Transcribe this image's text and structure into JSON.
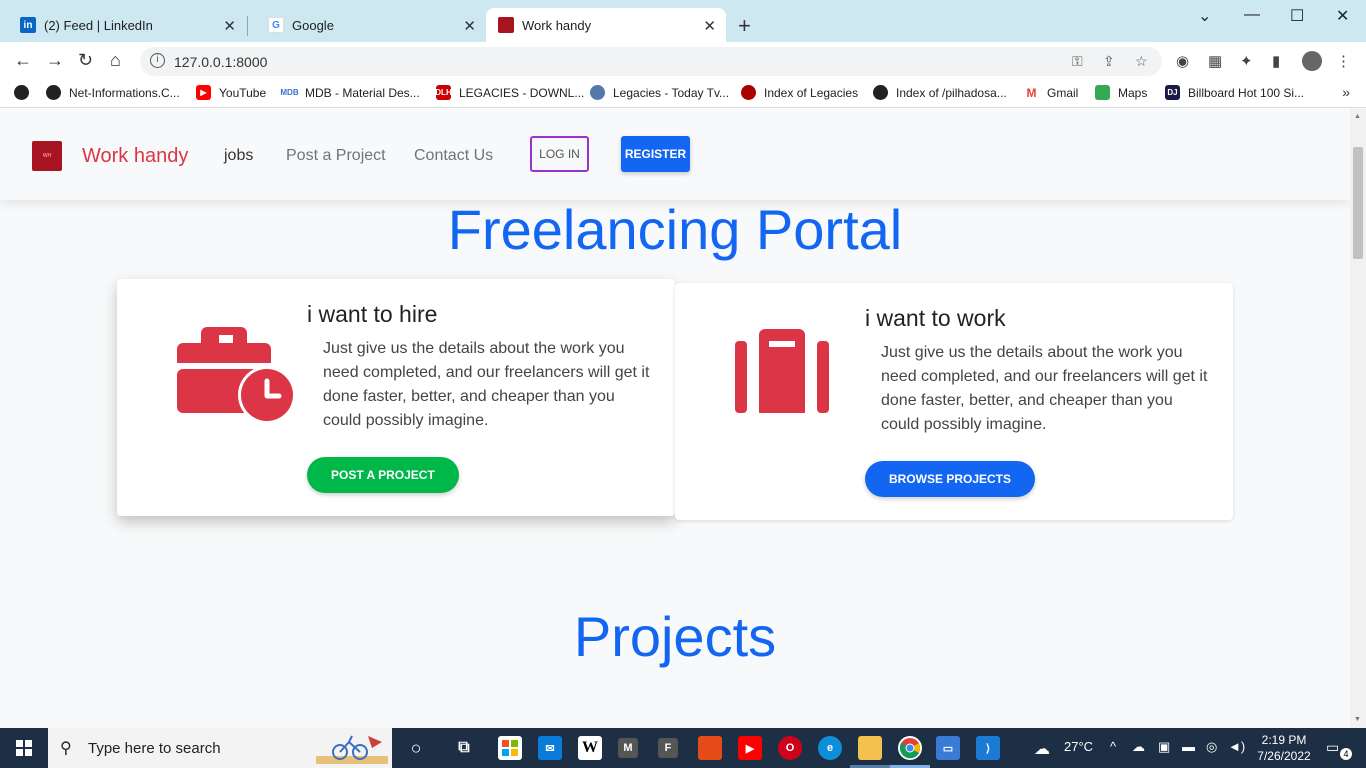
{
  "browser": {
    "tabs": [
      {
        "title": "(2) Feed | LinkedIn",
        "icon": "linkedin-icon"
      },
      {
        "title": "Google",
        "icon": "google-icon"
      },
      {
        "title": "Work handy",
        "icon": "site-icon",
        "active": true
      }
    ],
    "address": "127.0.0.1:8000",
    "bookmarks": [
      {
        "label": "Net-Informations.C...",
        "icon": "globe-icon"
      },
      {
        "label": "YouTube",
        "icon": "youtube-icon"
      },
      {
        "label": "MDB - Material Des...",
        "icon": "mdb-icon"
      },
      {
        "label": "LEGACIES - DOWNL...",
        "icon": "dlh-icon"
      },
      {
        "label": "Legacies - Today Tv...",
        "icon": "film-icon"
      },
      {
        "label": "Index of Legacies",
        "icon": "legacies-icon"
      },
      {
        "label": "Index of /pilhadosa...",
        "icon": "globe-icon"
      },
      {
        "label": "Gmail",
        "icon": "gmail-icon"
      },
      {
        "label": "Maps",
        "icon": "maps-icon"
      },
      {
        "label": "Billboard Hot 100 Si...",
        "icon": "billboard-icon"
      }
    ]
  },
  "site": {
    "brand": "Work handy",
    "nav": [
      "jobs",
      "Post a Project",
      "Contact Us"
    ],
    "login": "LOG IN",
    "register": "REGISTER",
    "hero_title": "Freelancing Portal",
    "cards": [
      {
        "title": "i want to hire",
        "text": "Just give us the details about the work you need completed, and our freelancers will get it done faster, better, and cheaper than you could possibly imagine.",
        "button": "POST A PROJECT",
        "icon": "briefcase-clock-icon"
      },
      {
        "title": "i want to work",
        "text": "Just give us the details about the work you need completed, and our freelancers will get it done faster, better, and cheaper than you could possibly imagine.",
        "button": "BROWSE PROJECTS",
        "icon": "suitcase-icon"
      }
    ],
    "projects_title": "Projects"
  },
  "taskbar": {
    "search_placeholder": "Type here to search",
    "temperature": "27°C",
    "time": "2:19 PM",
    "date": "7/26/2022",
    "notifications": "4"
  },
  "colors": {
    "primary": "#1266f1",
    "danger": "#dc3545",
    "success": "#00b74a",
    "login_border": "#9933cc"
  }
}
